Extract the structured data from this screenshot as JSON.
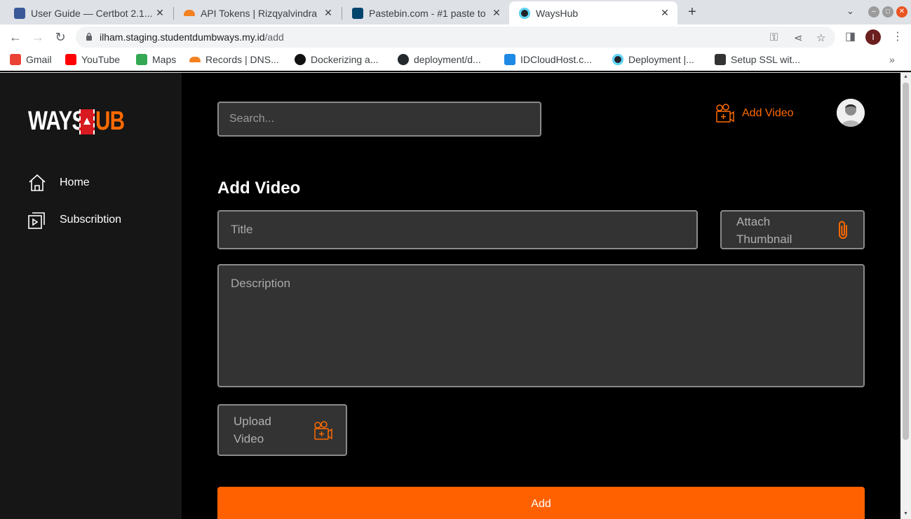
{
  "browser": {
    "tabs": [
      {
        "title": "User Guide — Certbot 2.1...",
        "favicon_color": "#3b5998",
        "active": false
      },
      {
        "title": "API Tokens | Rizqyalvindra",
        "favicon_color": "#f48120",
        "active": false
      },
      {
        "title": "Pastebin.com - #1 paste to",
        "favicon_color": "#02456c",
        "active": false
      },
      {
        "title": "WaysHub",
        "favicon_color": "#61dafb",
        "active": true
      }
    ],
    "url_host": "ilham.staging.studentdumbways.my.id",
    "url_path": "/add",
    "profile_initial": "I",
    "bookmarks": [
      {
        "label": "Gmail",
        "icon": "gmail-icon",
        "color": "#ea4335"
      },
      {
        "label": "YouTube",
        "icon": "youtube-icon",
        "color": "#ff0000"
      },
      {
        "label": "Maps",
        "icon": "maps-icon",
        "color": "#34a853"
      },
      {
        "label": "Records | DNS...",
        "icon": "cloudflare-icon",
        "color": "#f48120"
      },
      {
        "label": "Dockerizing a...",
        "icon": "docker-icon",
        "color": "#111111"
      },
      {
        "label": "deployment/d...",
        "icon": "github-icon",
        "color": "#24292e"
      },
      {
        "label": "IDCloudHost.c...",
        "icon": "idcloudhost-icon",
        "color": "#1e88e5"
      },
      {
        "label": "Deployment |...",
        "icon": "react-icon",
        "color": "#61dafb"
      },
      {
        "label": "Setup SSL wit...",
        "icon": "ssl-icon",
        "color": "#333333"
      }
    ],
    "bookmarks_more": "»"
  },
  "app": {
    "logo_left": "WAYS",
    "logo_right": "UB",
    "brand_color": "#ff6100",
    "nav": [
      {
        "label": "Home",
        "icon": "home-icon"
      },
      {
        "label": "Subscribtion",
        "icon": "subscription-icon"
      }
    ],
    "search_placeholder": "Search...",
    "header_add_video": "Add Video"
  },
  "form": {
    "title": "Add Video",
    "title_placeholder": "Title",
    "attach_thumbnail": "Attach Thumbnail",
    "description_placeholder": "Description",
    "upload_video": "Upload Video",
    "submit": "Add"
  }
}
